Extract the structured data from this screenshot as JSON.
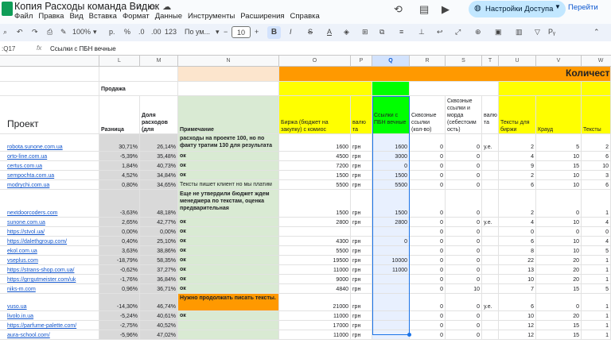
{
  "doc": {
    "title": "Копия  Расходы команда Видюк",
    "menu": [
      "Файл",
      "Правка",
      "Вид",
      "Вставка",
      "Формат",
      "Данные",
      "Инструменты",
      "Расширения",
      "Справка"
    ],
    "share_label": "Настройки Доступа",
    "go_label": "Перейти"
  },
  "toolbar": {
    "zoom": "100%",
    "currency": "р.",
    "percent": "%",
    "dec_dec": ".0",
    "dec_inc": ".00",
    "format123": "123",
    "font": "По ум...",
    "font_size": "10"
  },
  "formula": {
    "cell_ref": ":Q17",
    "value": "Ссылки с ПБН вечные"
  },
  "columns": [
    {
      "letter": "L",
      "sel": false
    },
    {
      "letter": "M",
      "sel": false
    },
    {
      "letter": "N",
      "sel": false
    },
    {
      "letter": "O",
      "sel": false
    },
    {
      "letter": "P",
      "sel": false
    },
    {
      "letter": "Q",
      "sel": true
    },
    {
      "letter": "R",
      "sel": false
    },
    {
      "letter": "S",
      "sel": false
    },
    {
      "letter": "T",
      "sel": false
    },
    {
      "letter": "U",
      "sel": false
    },
    {
      "letter": "V",
      "sel": false
    },
    {
      "letter": "W",
      "sel": false
    }
  ],
  "header": {
    "kolichestvo": "Количест",
    "prodazha": "Продажа",
    "proekt": "Проект",
    "raznitsa": "Разница",
    "dolya": "Доля расходов (для клиента)",
    "primechanie": "Примечание",
    "birzha": "Биржа (бюджет на закупку) с комиос",
    "valyuta": "валю та",
    "pbn": "Ссылки с ПБН вечные",
    "skvoznye": "Сквозные ссылки (кол-во)",
    "skvoznye_morda": "Сквозные ссылки и морда (себестоим ость)",
    "valyuta2": "валю та",
    "teksty_birzhi": "Тексты для биржи",
    "kraud": "Крауд",
    "teksty": "Тексты"
  },
  "rows": [
    {
      "project": "robota.sunone.com.ua",
      "diff": "30,71%",
      "share": "26,14%",
      "note": "расходы на проекте 100, но по факту тратим 130 для результата",
      "birzha": "1600",
      "cur": "грн",
      "pbn": "1600",
      "skv": "0",
      "skvm": "0",
      "cur2": "у.е.",
      "tb": "2",
      "kr": "5",
      "tx": "2"
    },
    {
      "project": "orto-line.com.ua",
      "diff": "-5,39%",
      "share": "35,48%",
      "note": "ок",
      "birzha": "4500",
      "cur": "грн",
      "pbn": "3000",
      "skv": "0",
      "skvm": "0",
      "cur2": "",
      "tb": "4",
      "kr": "10",
      "tx": "6"
    },
    {
      "project": "certus.com.ua",
      "diff": "1,84%",
      "share": "40,73%",
      "note": "ок",
      "birzha": "7200",
      "cur": "грн",
      "pbn": "0",
      "skv": "0",
      "skvm": "0",
      "cur2": "",
      "tb": "9",
      "kr": "15",
      "tx": "10"
    },
    {
      "project": "sempochta.com.ua",
      "diff": "4,52%",
      "share": "34,84%",
      "note": "ок",
      "birzha": "1500",
      "cur": "грн",
      "pbn": "1500",
      "skv": "0",
      "skvm": "0",
      "cur2": "",
      "tb": "2",
      "kr": "10",
      "tx": "3"
    },
    {
      "project": "modrychi.com.ua",
      "diff": "0,80%",
      "share": "34,65%",
      "note": "Тексты пишет клиент но мы платим",
      "birzha": "5500",
      "cur": "грн",
      "pbn": "5500",
      "skv": "0",
      "skvm": "0",
      "cur2": "",
      "tb": "6",
      "kr": "10",
      "tx": "6"
    },
    {
      "project": "nextdoorcoders.com",
      "diff": "-3,63%",
      "share": "48,18%",
      "note": "Еще не утвердили бюджет ждем менеджера по текстам, оценка предварительная",
      "birzha": "1500",
      "cur": "грн",
      "pbn": "1500",
      "skv": "0",
      "skvm": "0",
      "cur2": "",
      "tb": "2",
      "kr": "0",
      "tx": "1"
    },
    {
      "project": "sunone.com.ua",
      "diff": "2,65%",
      "share": "42,77%",
      "note": "ок",
      "birzha": "2800",
      "cur": "грн",
      "pbn": "2800",
      "skv": "0",
      "skvm": "0",
      "cur2": "у.е.",
      "tb": "4",
      "kr": "10",
      "tx": "4"
    },
    {
      "project": "https://stvol.ua/",
      "diff": "0,00%",
      "share": "0,00%",
      "note": "ок",
      "birzha": "",
      "cur": "",
      "pbn": "",
      "skv": "0",
      "skvm": "0",
      "cur2": "",
      "tb": "0",
      "kr": "0",
      "tx": "0"
    },
    {
      "project": "https://dalethgroup.com/",
      "diff": "0,40%",
      "share": "25,10%",
      "note": "ок",
      "birzha": "4300",
      "cur": "грн",
      "pbn": "0",
      "skv": "0",
      "skvm": "0",
      "cur2": "",
      "tb": "6",
      "kr": "10",
      "tx": "4"
    },
    {
      "project": "ekol.com.ua",
      "diff": "3,63%",
      "share": "38,86%",
      "note": "ок",
      "birzha": "5500",
      "cur": "грн",
      "pbn": "",
      "skv": "0",
      "skvm": "0",
      "cur2": "",
      "tb": "8",
      "kr": "10",
      "tx": "5"
    },
    {
      "project": "vseplus.com",
      "diff": "-18,79%",
      "share": "58,35%",
      "note": "ок",
      "birzha": "19500",
      "cur": "грн",
      "pbn": "10000",
      "skv": "0",
      "skvm": "0",
      "cur2": "",
      "tb": "22",
      "kr": "20",
      "tx": "1"
    },
    {
      "project": "https://strans-shop.com.ua/",
      "diff": "-0,62%",
      "share": "37,27%",
      "note": "ок",
      "birzha": "11000",
      "cur": "грн",
      "pbn": "11000",
      "skv": "0",
      "skvm": "0",
      "cur2": "",
      "tb": "13",
      "kr": "20",
      "tx": "1"
    },
    {
      "project": "https://grrgutmeister.com/uk",
      "diff": "-1,76%",
      "share": "36,84%",
      "note": "ок",
      "birzha": "9000",
      "cur": "грн",
      "pbn": "",
      "skv": "0",
      "skvm": "0",
      "cur2": "",
      "tb": "10",
      "kr": "20",
      "tx": "1"
    },
    {
      "project": "niks-m.com",
      "diff": "0,96%",
      "share": "36,71%",
      "note": "ок",
      "birzha": "4840",
      "cur": "грн",
      "pbn": "",
      "skv": "0",
      "skvm": "10",
      "cur2": "",
      "tb": "7",
      "kr": "15",
      "tx": "5"
    },
    {
      "project": "vuso.ua",
      "diff": "-14,30%",
      "share": "46,74%",
      "note": "Нужно продолжать писать тексты.",
      "birzha": "21000",
      "cur": "грн",
      "pbn": "",
      "skv": "0",
      "skvm": "0",
      "cur2": "у.е.",
      "tb": "6",
      "kr": "0",
      "tx": "1"
    },
    {
      "project": "livolo.in.ua",
      "diff": "-5,24%",
      "share": "40,61%",
      "note": "ок",
      "birzha": "11000",
      "cur": "грн",
      "pbn": "",
      "skv": "0",
      "skvm": "0",
      "cur2": "",
      "tb": "10",
      "kr": "20",
      "tx": "1"
    },
    {
      "project": "https://parfume-palette.com/",
      "diff": "-2,75%",
      "share": "40,52%",
      "note": "",
      "birzha": "17000",
      "cur": "грн",
      "pbn": "",
      "skv": "0",
      "skvm": "0",
      "cur2": "",
      "tb": "12",
      "kr": "15",
      "tx": "1"
    },
    {
      "project": "aura-school.com/",
      "diff": "-5,96%",
      "share": "47,02%",
      "note": "",
      "birzha": "11000",
      "cur": "грн",
      "pbn": "",
      "skv": "0",
      "skvm": "0",
      "cur2": "",
      "tb": "12",
      "kr": "15",
      "tx": "1"
    }
  ],
  "colors": {
    "green": "#d9ead3",
    "grey": "#d9d9d9",
    "orange": "#ff9900",
    "yellow": "#ffff00",
    "pbn_green": "#00ff00",
    "peach": "#fce5cd",
    "selection": "#e8f0fe",
    "accent": "#1a73e8"
  }
}
